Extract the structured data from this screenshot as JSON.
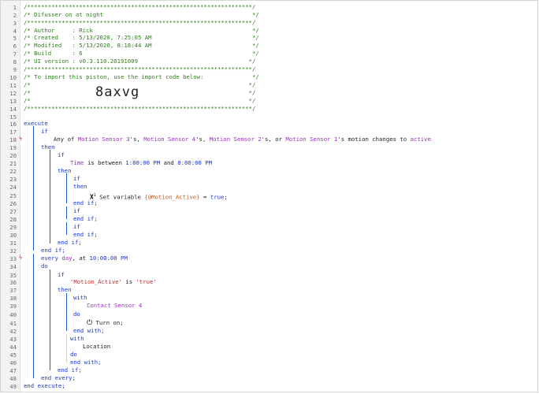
{
  "line_numbers": [
    "1",
    "2",
    "3",
    "4",
    "5",
    "6",
    "7",
    "8",
    "9",
    "10",
    "11",
    "12",
    "13",
    "14",
    "15",
    "16",
    "17",
    "18",
    "19",
    "20",
    "21",
    "22",
    "23",
    "24",
    "25",
    "26",
    "27",
    "28",
    "29",
    "30",
    "31",
    "32",
    "33",
    "34",
    "35",
    "36",
    "37",
    "38",
    "39",
    "40",
    "41",
    "42",
    "43",
    "44",
    "45",
    "46",
    "47",
    "48",
    "49"
  ],
  "header": {
    "stars": "/*****************************************************************/",
    "title": "/* Difusser on at night                                           */",
    "author": "/* Author     : Rick                                              */",
    "created": "/* Created    : 5/13/2020, 7:25:05 AM                             */",
    "modified": "/* Modified   : 5/13/2020, 8:18:44 AM                             */",
    "build": "/* Build      : 6                                                 */",
    "ui_version": "/* UI version : v0.3.110.20191009                                */",
    "import_note": "/* To import this piston, use the import code below:              */",
    "blank": "/*                                                               */",
    "import_code": "8axvg"
  },
  "code": {
    "execute": "execute",
    "if": "if",
    "then": "then",
    "do": "do",
    "with": "with",
    "end_if": "end if;",
    "end_with": "end with;",
    "end_every": "end every;",
    "end_execute": "end execute;",
    "any_of": "Any of ",
    "motion3": "Motion Sensor 3",
    "poss_comma": "'s, ",
    "motion4": "Motion Sensor 4",
    "motion2": "Motion Sensor 2",
    "or": "'s, or ",
    "motion1": "Motion Sensor 1",
    "motion_changes": "'s motion changes to ",
    "active": "active",
    "time": "Time",
    "is_between": " is between ",
    "time_start": "1:00:00 PM",
    "and": " and ",
    "time_end": "8:00:00 PM",
    "x_icon": "X",
    "x_sup": "1",
    "set_variable": " Set variable ",
    "var_name": "{@Motion_Active}",
    "equals": " = ",
    "true_val": "true",
    "semicolon": ";",
    "every": "every ",
    "day": "day",
    "at": ", at ",
    "every_time": "10:00:00 PM",
    "motion_active_str": "'Motion_Active'",
    "is": " is ",
    "true_str": "'true'",
    "contact": "Contact Sensor 4",
    "turn_on": " Turn on;",
    "location": "Location"
  }
}
